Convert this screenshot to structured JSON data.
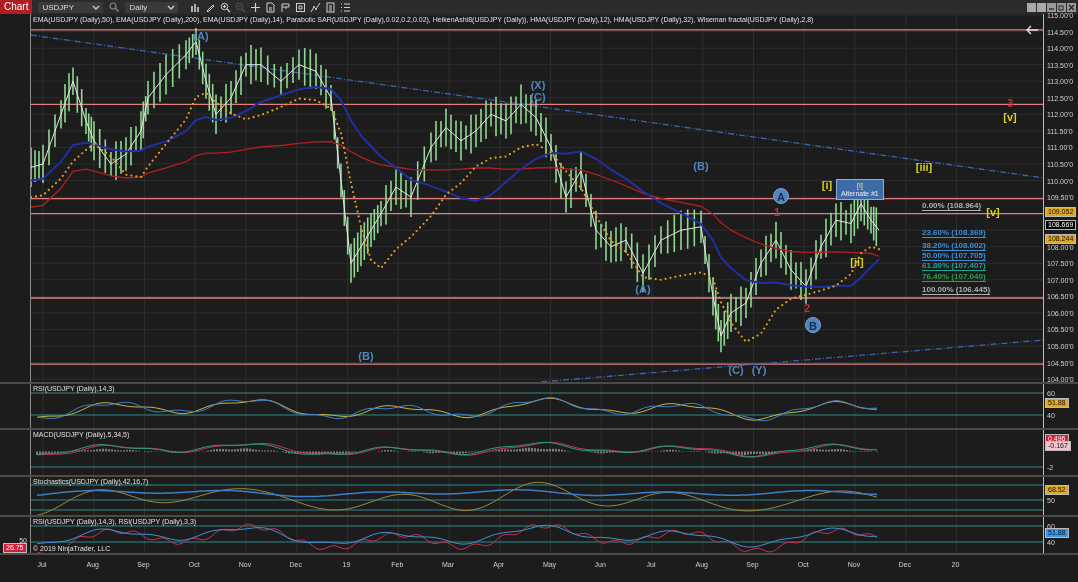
{
  "window": {
    "title": "Chart"
  },
  "toolbar": {
    "instrument": "USDJPY",
    "interval": "Daily",
    "tools": [
      {
        "kind": "bars",
        "disabled": false
      },
      {
        "kind": "pencil",
        "disabled": false
      },
      {
        "kind": "zoom-in",
        "disabled": false
      },
      {
        "kind": "zoom-out",
        "disabled": true
      },
      {
        "kind": "plus",
        "disabled": false
      },
      {
        "kind": "document",
        "disabled": false
      },
      {
        "kind": "flag",
        "disabled": false
      },
      {
        "kind": "frame",
        "disabled": false
      },
      {
        "kind": "graph",
        "disabled": false
      },
      {
        "kind": "calculator",
        "disabled": false
      },
      {
        "kind": "list",
        "disabled": false
      }
    ]
  },
  "legend": "EMA(USDJPY (Daily),50), EMA(USDJPY (Daily),200), EMA(USDJPY (Daily),14), Parabolic SAR(USDJPY (Daily),0.02,0.2,0.02), HeikenAshi8(USDJPY (Daily)), HMA(USDJPY (Daily),12), HMA(USDJPY (Daily),32), Wiseman fractal(USDJPY (Daily),2,8)",
  "wave_labels": [
    {
      "text": "(A)",
      "kind": "text",
      "color": "#4f86c0"
    },
    {
      "text": "(X)",
      "kind": "text",
      "color": "#4f86c0"
    },
    {
      "text": "(C)",
      "kind": "text",
      "color": "#4f86c0"
    },
    {
      "text": "(B)",
      "kind": "text",
      "color": "#4f86c0"
    },
    {
      "text": "(B)",
      "kind": "text",
      "color": "#4f86c0"
    },
    {
      "text": "(A)",
      "kind": "text",
      "color": "#4f86c0"
    },
    {
      "text": "(C)",
      "kind": "text",
      "color": "#4f86c0"
    },
    {
      "text": "(Y)",
      "kind": "text",
      "color": "#4f86c0"
    },
    {
      "text": "A",
      "kind": "circle",
      "color": "#4f86c0"
    },
    {
      "text": "1",
      "kind": "text",
      "color": "#c0303a"
    },
    {
      "text": "2",
      "kind": "text",
      "color": "#c0303a"
    },
    {
      "text": "B",
      "kind": "circle",
      "color": "#4f86c0"
    },
    {
      "text": "3",
      "kind": "text",
      "color": "#c0303a"
    },
    {
      "text": "[v]",
      "kind": "text",
      "color": "#d8d020"
    },
    {
      "text": "[iii]",
      "kind": "text",
      "color": "#d8d020"
    },
    {
      "text": "[i]",
      "kind": "text",
      "color": "#d8d020"
    },
    {
      "text": "[ii]",
      "kind": "text",
      "color": "#d8d020"
    },
    {
      "text": "[v]",
      "kind": "text",
      "color": "#d8d020"
    }
  ],
  "alternate_box": {
    "wave": "[i]",
    "title": "Alternate #1"
  },
  "fibonacci": [
    {
      "text": "0.00% (108.964)",
      "color": "#b0b0b0"
    },
    {
      "text": "23.60% (108.369)",
      "color": "#3c8fd8"
    },
    {
      "text": "38.20% (108.002)",
      "color": "#3c8fd8"
    },
    {
      "text": "50.00% (107.705)",
      "color": "#3c8fd8"
    },
    {
      "text": "61.80% (107.407)",
      "color": "#1fa38f"
    },
    {
      "text": "76.40% (107.040)",
      "color": "#2f9e4f"
    },
    {
      "text": "100.00% (106.445)",
      "color": "#b0b0b0"
    }
  ],
  "price_axis": {
    "ticks": [
      "115.00'0",
      "114.50'0",
      "114.00'0",
      "113.50'0",
      "113.00'0",
      "112.50'0",
      "112.00'0",
      "111.50'0",
      "111.00'0",
      "110.50'0",
      "110.00'0",
      "109.50'0",
      "108.00'0",
      "107.50'0",
      "107.00'0",
      "106.50'0",
      "106.00'0",
      "105.50'0",
      "105.00'0",
      "104.50'0",
      "104.00'0"
    ],
    "markers": [
      {
        "value": "109.052",
        "color": "#e0a822"
      },
      {
        "value": "108.669",
        "color": "#000000"
      },
      {
        "value": "108.244",
        "color": "#e0a822"
      }
    ]
  },
  "panes": [
    {
      "kind": "rsi",
      "title": "RSI(USDJPY (Daily),14,3)",
      "ticks": [
        "60",
        "40"
      ],
      "markers": [
        {
          "value": "51.88",
          "color": "#e0a822"
        }
      ]
    },
    {
      "kind": "macd",
      "title": "MACD(USDJPY (Daily),5,34,5)",
      "ticks": [
        "-2"
      ],
      "markers": [
        {
          "value": "0.496",
          "color": "#d0203a"
        },
        {
          "value": "-0.167",
          "color": "#f4c4cc"
        }
      ]
    },
    {
      "kind": "stochastics",
      "title": "Stochastics(USDJPY (Daily),42,16,7)",
      "ticks": [
        "50"
      ],
      "markers": [
        {
          "value": "68.52",
          "color": "#e0a822"
        }
      ]
    },
    {
      "kind": "rsi2",
      "title": "RSI(USDJPY (Daily),14,3), RSI(USDJPY (Daily),3,3)",
      "ticks": [
        "60",
        "40"
      ],
      "markers": [
        {
          "value": "51.88",
          "color": "#3399ee"
        }
      ],
      "left_ticks": [
        "50"
      ],
      "left_markers": [
        {
          "value": "26.75",
          "color": "#d0203a"
        }
      ]
    }
  ],
  "copyright": "© 2019 NinjaTrader, LLC",
  "time_axis": [
    "Jul",
    "Aug",
    "Sep",
    "Oct",
    "Nov",
    "Dec",
    "19",
    "Feb",
    "Mar",
    "Apr",
    "May",
    "Jun",
    "Jul",
    "Aug",
    "Sep",
    "Oct",
    "Nov",
    "Dec",
    "20"
  ]
}
